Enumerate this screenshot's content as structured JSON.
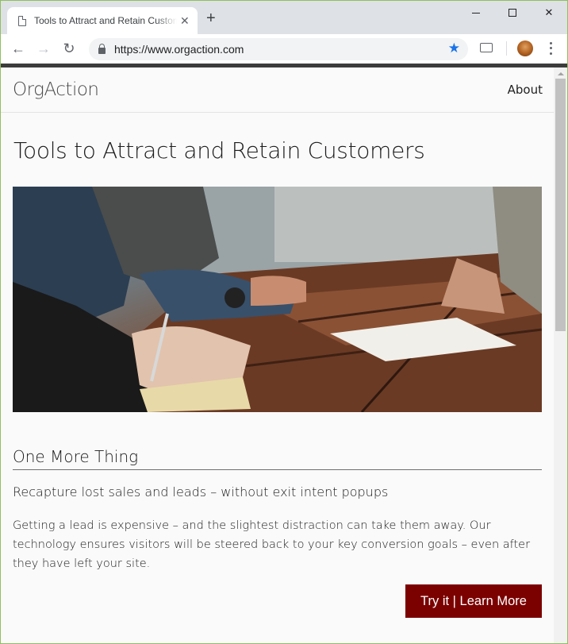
{
  "browser": {
    "tab_title": "Tools to Attract and Retain Customers",
    "tab_close": "✕",
    "new_tab": "+",
    "url": "https://www.orgaction.com",
    "back": "←",
    "forward": "→",
    "reload": "↻",
    "star": "★",
    "win_close": "✕"
  },
  "site": {
    "brand": "OrgAction",
    "nav": {
      "about": "About"
    }
  },
  "page": {
    "title": "Tools to Attract and Retain Customers",
    "section_heading": "One More Thing",
    "subheading": "Recapture lost sales and leads – without exit intent popups",
    "body": "Getting a lead is expensive – and the slightest distraction can take them away. Our technology ensures visitors will be steered back to your key conversion goals – even after they have left your site.",
    "cta": "Try it | Learn More"
  },
  "colors": {
    "cta_bg": "#7b0000",
    "star": "#1a73e8"
  },
  "icons": [
    "page-icon",
    "close-icon",
    "plus-icon",
    "minimize-icon",
    "maximize-icon",
    "back-icon",
    "forward-icon",
    "reload-icon",
    "lock-icon",
    "star-icon",
    "cast-icon",
    "avatar",
    "menu-icon"
  ]
}
